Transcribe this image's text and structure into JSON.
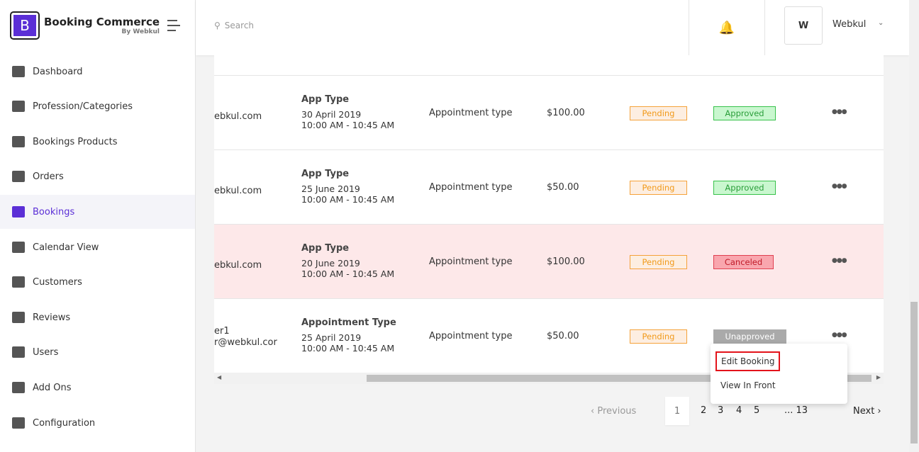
{
  "brand": {
    "title": "Booking Commerce",
    "subtitle": "By Webkul",
    "letter": "B"
  },
  "sidebar": {
    "items": [
      {
        "label": "Dashboard",
        "icon": "dashboard-icon"
      },
      {
        "label": "Profession/Categories",
        "icon": "categories-icon"
      },
      {
        "label": "Bookings Products",
        "icon": "calendar-product-icon"
      },
      {
        "label": "Orders",
        "icon": "orders-icon"
      },
      {
        "label": "Bookings",
        "icon": "bookings-icon",
        "active": true
      },
      {
        "label": "Calendar View",
        "icon": "grid-calendar-icon"
      },
      {
        "label": "Customers",
        "icon": "user-icon"
      },
      {
        "label": "Reviews",
        "icon": "star-icon"
      },
      {
        "label": "Users",
        "icon": "users-icon"
      },
      {
        "label": "Add Ons",
        "icon": "puzzle-icon"
      },
      {
        "label": "Configuration",
        "icon": "gear-icon"
      }
    ]
  },
  "header": {
    "search_placeholder": "Search",
    "avatar": "W",
    "username": "Webkul"
  },
  "rows": [
    {
      "email": "ebkul.com",
      "app_title": "App Type",
      "date": "30 April 2019",
      "time": "10:00 AM - 10:45 AM",
      "type": "Appointment type",
      "price": "$100.00",
      "payment": "Pending",
      "status": "Approved"
    },
    {
      "email": "ebkul.com",
      "app_title": "App Type",
      "date": "25 June 2019",
      "time": "10:00 AM - 10:45 AM",
      "type": "Appointment type",
      "price": "$50.00",
      "payment": "Pending",
      "status": "Approved"
    },
    {
      "email": "ebkul.com",
      "app_title": "App Type",
      "date": "20 June 2019",
      "time": "10:00 AM - 10:45 AM",
      "type": "Appointment type",
      "price": "$100.00",
      "payment": "Pending",
      "status": "Canceled"
    },
    {
      "email_line1": "er1",
      "email": "r@webkul.cor",
      "app_title": "Appointment Type",
      "date": "25 April 2019",
      "time": "10:00 AM - 10:45 AM",
      "type": "Appointment type",
      "price": "$50.00",
      "payment": "Pending",
      "status": "Unapproved"
    }
  ],
  "menu": {
    "edit": "Edit Booking",
    "view": "View In Front"
  },
  "pagination": {
    "previous": "Previous",
    "pages": [
      "1",
      "2",
      "3",
      "4",
      "5"
    ],
    "last": "... 13",
    "next": "Next",
    "current": "1"
  },
  "colors": {
    "accent": "#5b2fd6",
    "highlight": "#e3131b"
  }
}
